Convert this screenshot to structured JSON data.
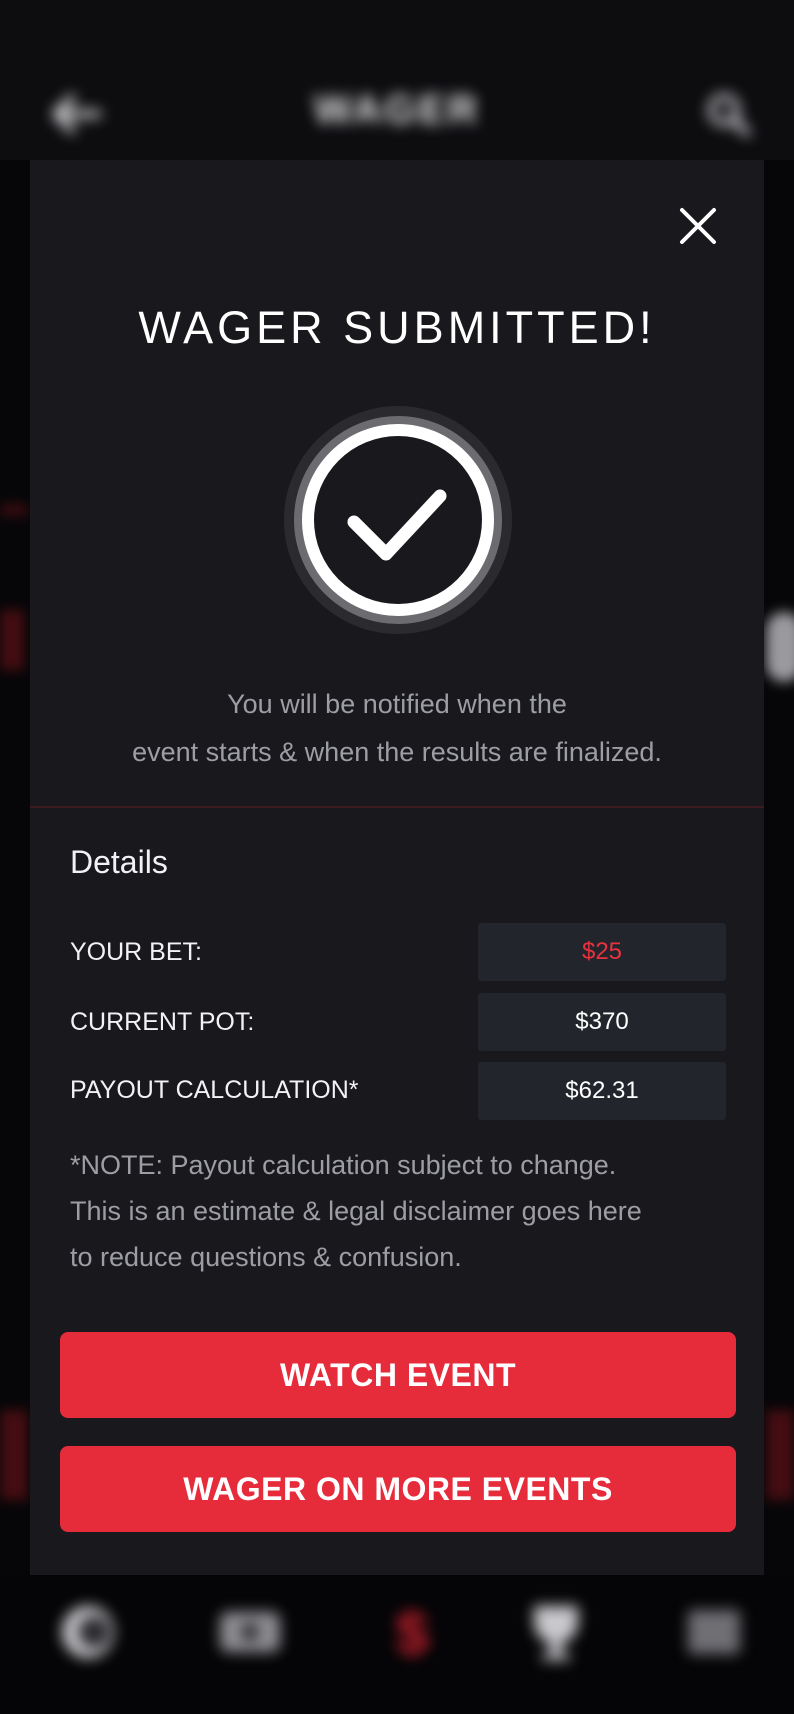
{
  "background": {
    "header_title": "WAGER",
    "back_icon": "arrow-left-icon",
    "search_icon": "search-icon",
    "nav_icons": [
      "coin-icon",
      "ticket-icon",
      "dollar-icon",
      "trophy-icon",
      "menu-icon"
    ]
  },
  "modal": {
    "close_icon": "close-icon",
    "title": "WAGER SUBMITTED!",
    "success_icon": "checkmark-circle-icon",
    "message_line1": "You will be notified when the",
    "message_line2": "event starts & when the results are finalized.",
    "details": {
      "heading": "Details",
      "rows": [
        {
          "label": "YOUR BET:",
          "value": "$25"
        },
        {
          "label": "CURRENT POT:",
          "value": "$370"
        },
        {
          "label": "PAYOUT CALCULATION*",
          "value": "$62.31"
        }
      ]
    },
    "note_lines": [
      "*NOTE: Payout calculation subject to change.",
      "This is an estimate & legal disclaimer goes here",
      "to reduce questions & confusion."
    ],
    "buttons": {
      "watch_event": "WATCH EVENT",
      "wager_more": "WAGER ON MORE EVENTS"
    }
  },
  "colors": {
    "accent": "#e62b3b",
    "modal_bg": "#19191d",
    "value_box": "#22252c",
    "bet_value": "#e8323f"
  }
}
